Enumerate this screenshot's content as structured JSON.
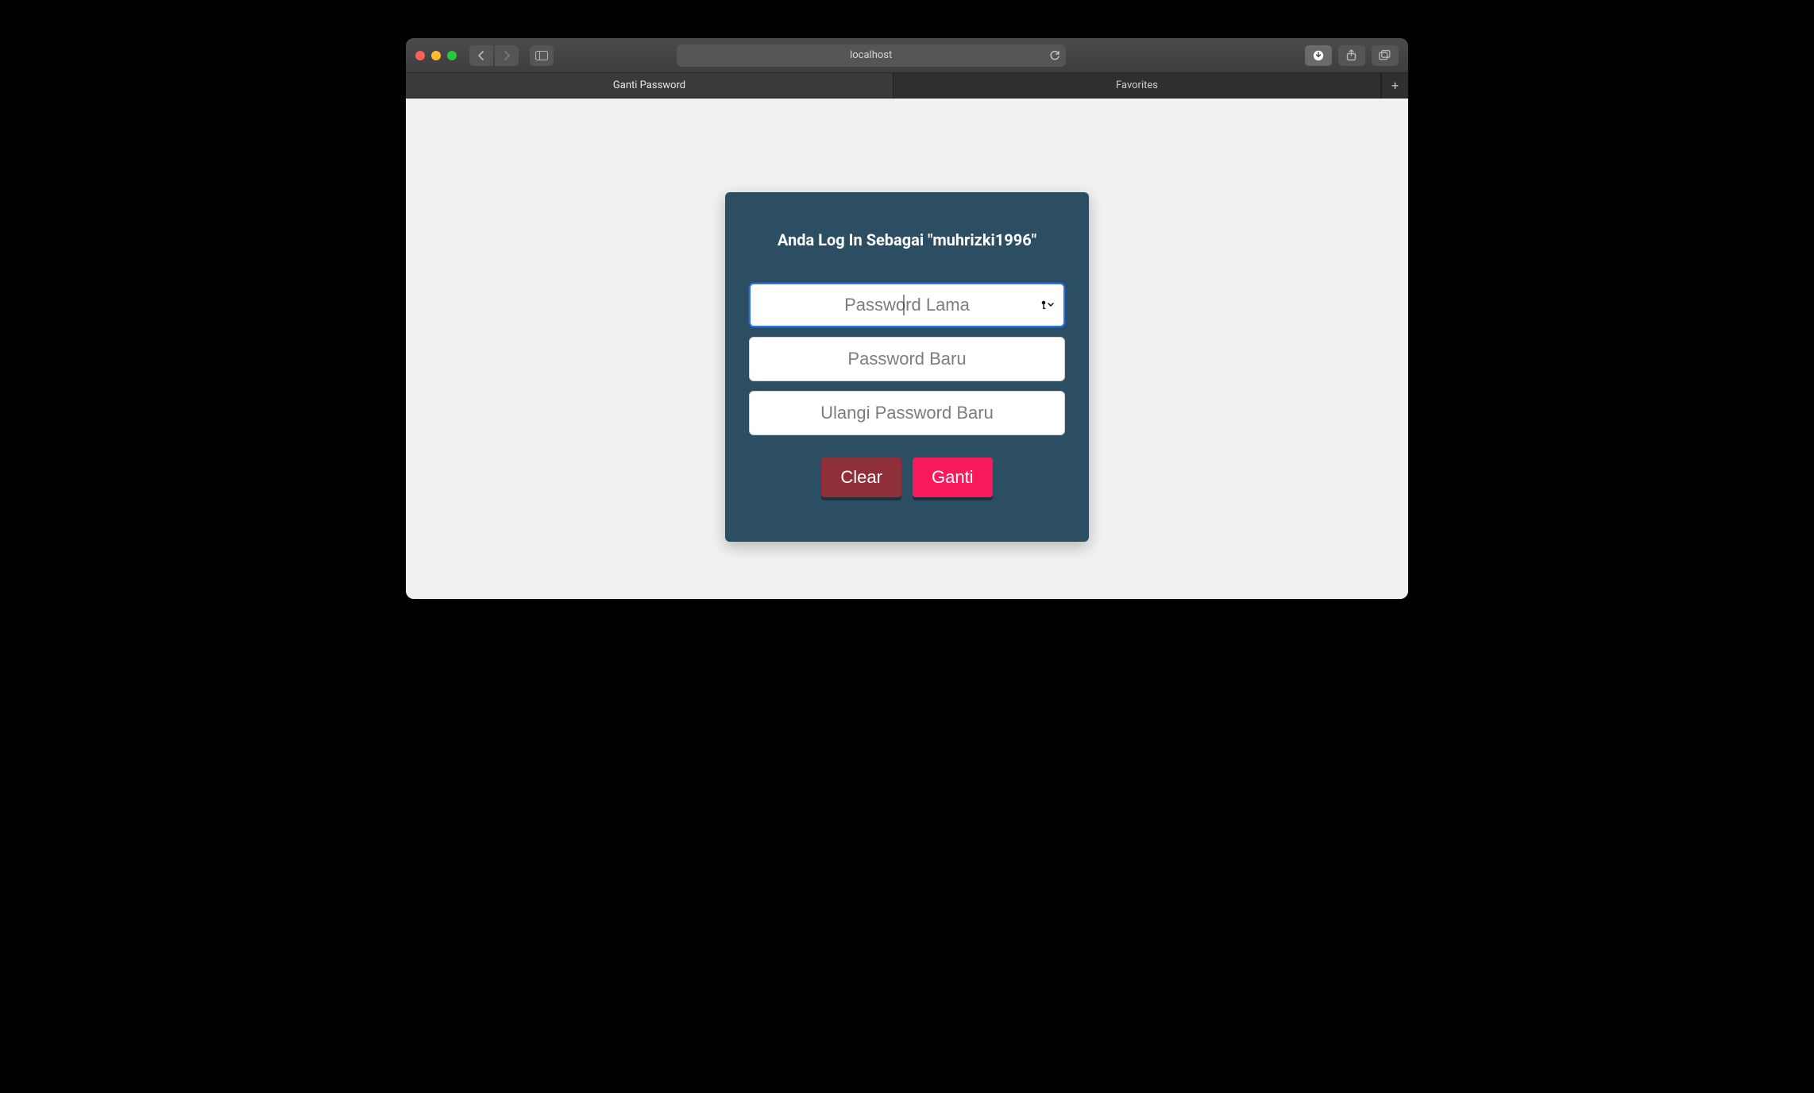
{
  "browser": {
    "address": "localhost",
    "tabs": [
      "Ganti Password",
      "Favorites"
    ]
  },
  "card": {
    "heading": "Anda Log In Sebagai \"muhrizki1996\"",
    "fields": {
      "old_password": {
        "placeholder": "Password Lama",
        "value": ""
      },
      "new_password": {
        "placeholder": "Password Baru",
        "value": ""
      },
      "repeat_password": {
        "placeholder": "Ulangi Password Baru",
        "value": ""
      }
    },
    "buttons": {
      "clear": "Clear",
      "submit": "Ganti"
    }
  },
  "colors": {
    "card_bg": "#2b4e63",
    "accent_submit": "#f81a5a",
    "accent_clear": "#8f2f3a",
    "page_bg": "#f1f1f1"
  }
}
